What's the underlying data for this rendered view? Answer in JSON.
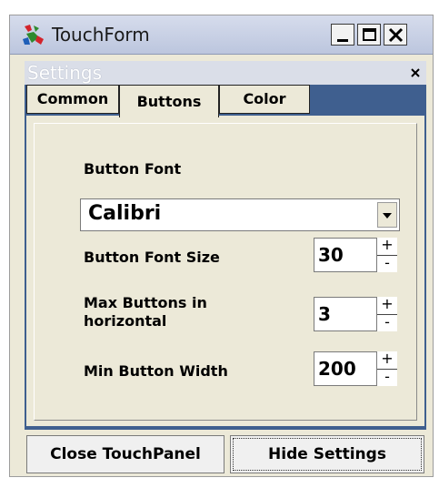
{
  "window": {
    "title": "TouchForm",
    "icon": "colorful-app-icon",
    "controls": [
      "minimize-icon",
      "maximize-icon",
      "close-icon"
    ]
  },
  "settings_panel": {
    "title": "Settings",
    "close_icon": "close-icon"
  },
  "tabs": [
    {
      "label": "Common",
      "active": false
    },
    {
      "label": "Buttons",
      "active": true
    },
    {
      "label": "Color",
      "active": false
    }
  ],
  "buttons_tab": {
    "font_label": "Button Font",
    "font_value": "Calibri",
    "font_size_label": "Button Font Size",
    "font_size_value": "30",
    "max_buttons_label_line1": "Max Buttons in",
    "max_buttons_label_line2": "horizontal",
    "max_buttons_value": "3",
    "min_width_label": "Min Button Width",
    "min_width_value": "200",
    "spin_up": "+",
    "spin_down": "-"
  },
  "footer": {
    "close_label": "Close TouchPanel",
    "hide_label": "Hide Settings"
  },
  "colors": {
    "tab_strip": "#3f5f8f",
    "window_bg": "#ece9d8"
  }
}
